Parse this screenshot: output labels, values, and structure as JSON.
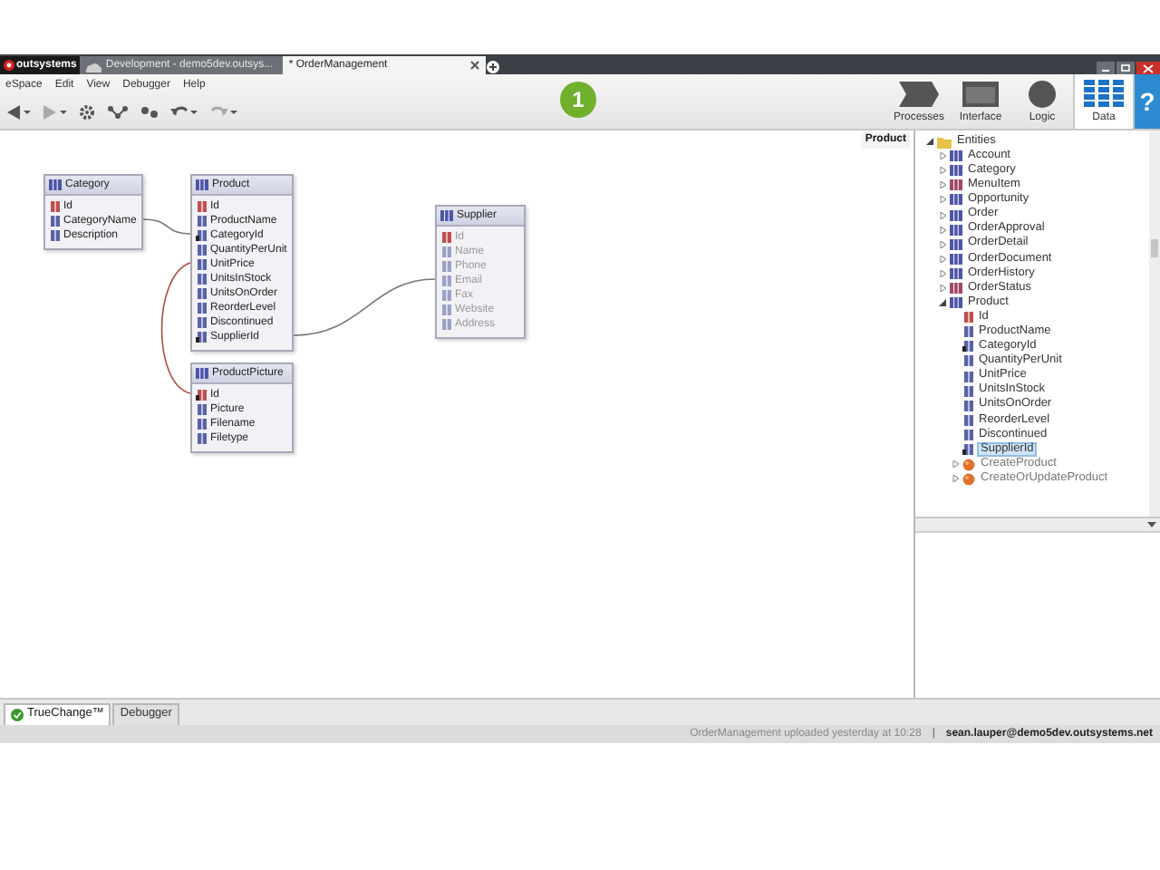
{
  "browser_tabs": [
    {
      "label": "Development - demo5dev.outsys...",
      "selected": false
    },
    {
      "label": "* OrderManagement",
      "selected": true
    }
  ],
  "brand": "outsystems",
  "menu": [
    "eSpace",
    "Edit",
    "View",
    "Debugger",
    "Help"
  ],
  "step_badge": "1",
  "modules": [
    {
      "label": "Processes",
      "kind": "processes",
      "selected": false
    },
    {
      "label": "Interface",
      "kind": "interface",
      "selected": false
    },
    {
      "label": "Logic",
      "kind": "logic",
      "selected": false
    },
    {
      "label": "Data",
      "kind": "data",
      "selected": true
    }
  ],
  "help": "?",
  "canvas_label": "Product",
  "entities": [
    {
      "name": "Category",
      "referenced": false,
      "fields": [
        {
          "name": "Id",
          "kind": "key"
        },
        {
          "name": "CategoryName",
          "kind": "plain"
        },
        {
          "name": "Description",
          "kind": "plain"
        }
      ]
    },
    {
      "name": "Product",
      "referenced": false,
      "fields": [
        {
          "name": "Id",
          "kind": "key"
        },
        {
          "name": "ProductName",
          "kind": "plain"
        },
        {
          "name": "CategoryId",
          "kind": "foreign"
        },
        {
          "name": "QuantityPerUnit",
          "kind": "plain"
        },
        {
          "name": "UnitPrice",
          "kind": "plain"
        },
        {
          "name": "UnitsInStock",
          "kind": "plain"
        },
        {
          "name": "UnitsOnOrder",
          "kind": "plain"
        },
        {
          "name": "ReorderLevel",
          "kind": "plain"
        },
        {
          "name": "Discontinued",
          "kind": "plain"
        },
        {
          "name": "SupplierId",
          "kind": "foreign"
        }
      ]
    },
    {
      "name": "Supplier",
      "referenced": true,
      "fields": [
        {
          "name": "Id",
          "kind": "key"
        },
        {
          "name": "Name",
          "kind": "plain"
        },
        {
          "name": "Phone",
          "kind": "plain"
        },
        {
          "name": "Email",
          "kind": "plain"
        },
        {
          "name": "Fax",
          "kind": "plain"
        },
        {
          "name": "Website",
          "kind": "plain"
        },
        {
          "name": "Address",
          "kind": "plain"
        }
      ]
    },
    {
      "name": "ProductPicture",
      "referenced": false,
      "fields": [
        {
          "name": "Id",
          "kind": "foreign_key"
        },
        {
          "name": "Picture",
          "kind": "plain"
        },
        {
          "name": "Filename",
          "kind": "plain"
        },
        {
          "name": "Filetype",
          "kind": "plain"
        }
      ]
    }
  ],
  "tree": [
    {
      "label": "Entities",
      "kind": "folder",
      "expanded": true,
      "selected": false,
      "children": [
        {
          "label": "Account",
          "kind": "entity",
          "expanded": false,
          "selected": false
        },
        {
          "label": "Category",
          "kind": "entity",
          "expanded": false,
          "selected": false
        },
        {
          "label": "MenuItem",
          "kind": "static_entity",
          "expanded": false,
          "selected": false
        },
        {
          "label": "Opportunity",
          "kind": "entity",
          "expanded": false,
          "selected": false
        },
        {
          "label": "Order",
          "kind": "entity",
          "expanded": false,
          "selected": false
        },
        {
          "label": "OrderApproval",
          "kind": "entity",
          "expanded": false,
          "selected": false
        },
        {
          "label": "OrderDetail",
          "kind": "entity",
          "expanded": false,
          "selected": false
        },
        {
          "label": "OrderDocument",
          "kind": "entity",
          "expanded": false,
          "selected": false
        },
        {
          "label": "OrderHistory",
          "kind": "entity",
          "expanded": false,
          "selected": false
        },
        {
          "label": "OrderStatus",
          "kind": "static_entity",
          "expanded": false,
          "selected": false
        },
        {
          "label": "Product",
          "kind": "entity",
          "expanded": true,
          "selected": false,
          "children": [
            {
              "label": "Id",
              "kind": "key",
              "selected": false
            },
            {
              "label": "ProductName",
              "kind": "attribute",
              "selected": false
            },
            {
              "label": "CategoryId",
              "kind": "foreign",
              "selected": false
            },
            {
              "label": "QuantityPerUnit",
              "kind": "attribute",
              "selected": false
            },
            {
              "label": "UnitPrice",
              "kind": "attribute",
              "selected": false
            },
            {
              "label": "UnitsInStock",
              "kind": "attribute",
              "selected": false
            },
            {
              "label": "UnitsOnOrder",
              "kind": "attribute",
              "selected": false
            },
            {
              "label": "ReorderLevel",
              "kind": "attribute",
              "selected": false
            },
            {
              "label": "Discontinued",
              "kind": "attribute",
              "selected": false
            },
            {
              "label": "SupplierId",
              "kind": "foreign",
              "selected": true
            },
            {
              "label": "CreateProduct",
              "kind": "action",
              "expanded": false,
              "selected": false
            },
            {
              "label": "CreateOrUpdateProduct",
              "kind": "action",
              "expanded": false,
              "selected": false
            }
          ]
        }
      ]
    }
  ],
  "bottom_tabs": [
    {
      "label": "TrueChange™",
      "kind": "truechange",
      "selected": true
    },
    {
      "label": "Debugger",
      "kind": "plain",
      "selected": false
    }
  ],
  "status_bar": {
    "message": "OrderManagement uploaded yesterday at 10:28",
    "separator": "|",
    "user": "sean.lauper@demo5dev.outsystems.net"
  }
}
